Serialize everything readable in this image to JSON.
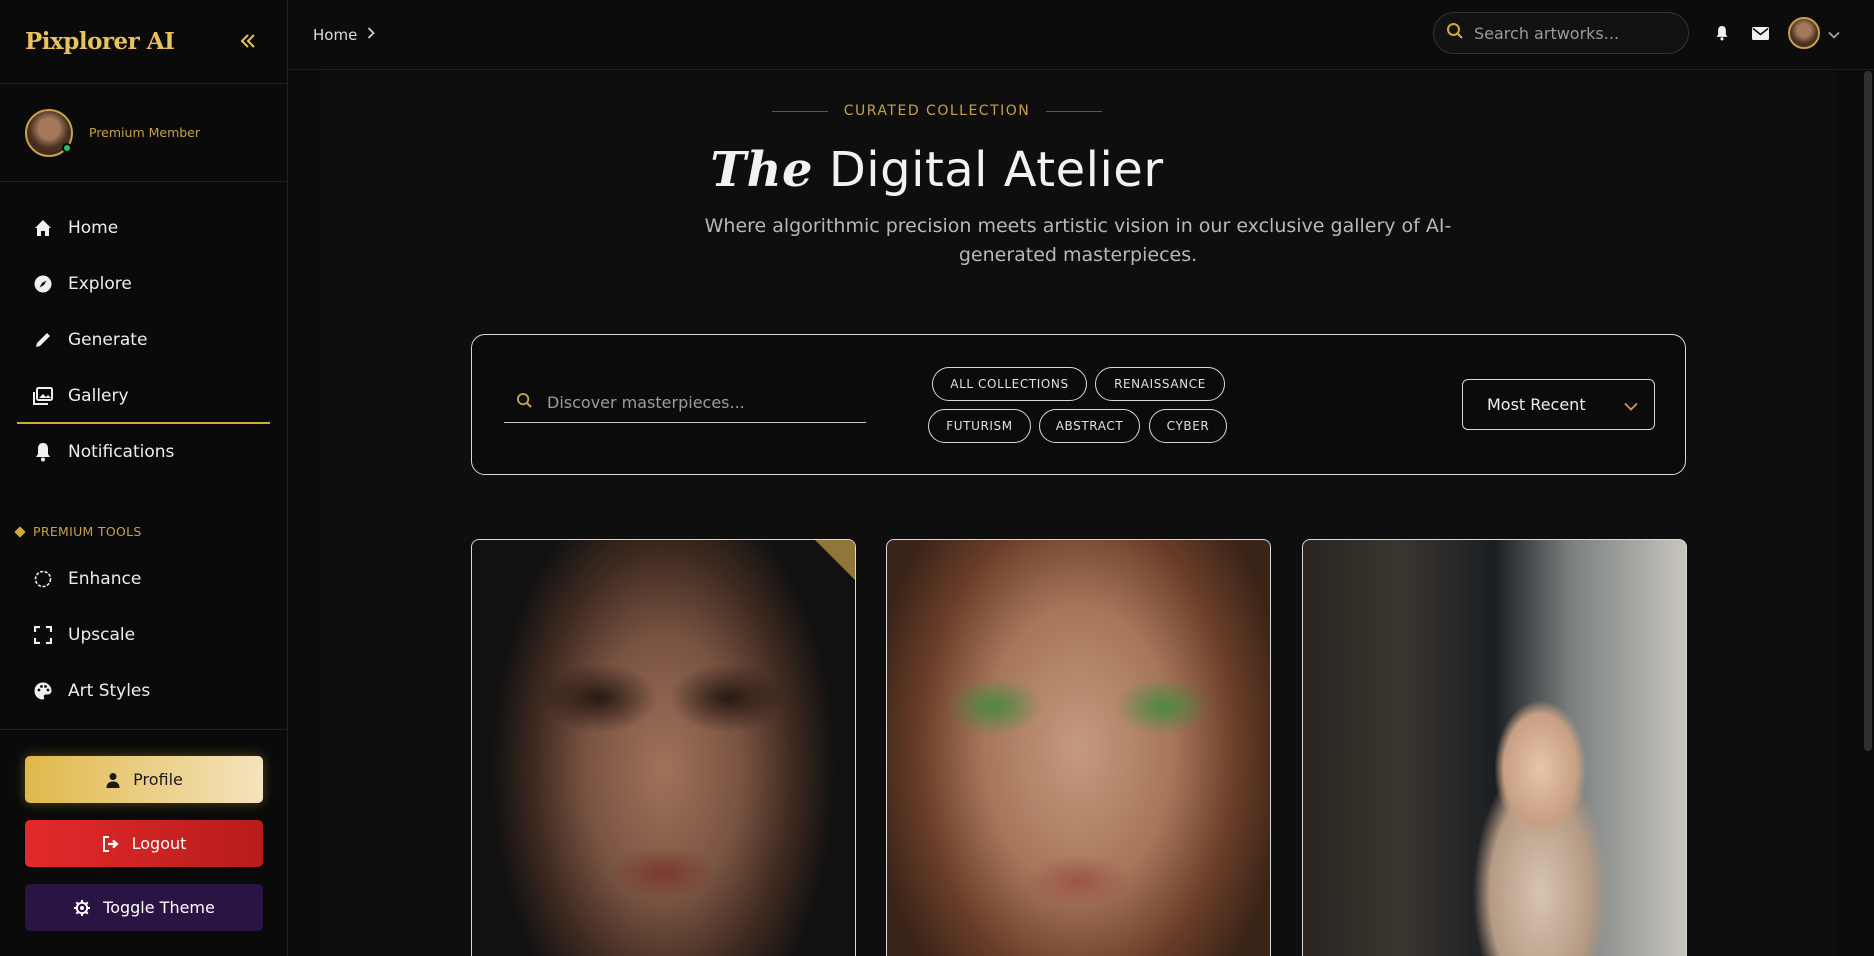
{
  "brand": {
    "name": "Pixplorer AI",
    "collapse_icon": "chevrons-left-icon"
  },
  "user": {
    "membership": "Premium Member",
    "online": true
  },
  "nav": {
    "items": [
      {
        "label": "Home",
        "icon": "home-icon",
        "active": false
      },
      {
        "label": "Explore",
        "icon": "compass-icon",
        "active": false
      },
      {
        "label": "Generate",
        "icon": "pencil-icon",
        "active": false
      },
      {
        "label": "Gallery",
        "icon": "images-icon",
        "active": true
      },
      {
        "label": "Notifications",
        "icon": "bell-icon",
        "active": false
      }
    ],
    "premium_label": "PREMIUM TOOLS",
    "premium_items": [
      {
        "label": "Enhance",
        "icon": "circle-icon"
      },
      {
        "label": "Upscale",
        "icon": "expand-icon"
      },
      {
        "label": "Art Styles",
        "icon": "palette-icon"
      }
    ]
  },
  "buttons": {
    "profile": "Profile",
    "logout": "Logout",
    "theme": "Toggle Theme"
  },
  "topbar": {
    "breadcrumb": "Home",
    "search_placeholder": "Search artworks..."
  },
  "hero": {
    "eyebrow": "CURATED COLLECTION",
    "title_em": "The",
    "title_rest": "Digital Atelier",
    "subtitle": "Where algorithmic precision meets artistic vision in our exclusive gallery of AI-generated masterpieces."
  },
  "filters": {
    "search_placeholder": "Discover masterpieces...",
    "chips": [
      "ALL COLLECTIONS",
      "RENAISSANCE",
      "FUTURISM",
      "ABSTRACT",
      "CYBER"
    ],
    "sort_selected": "Most Recent"
  },
  "colors": {
    "accent": "#d4a93c",
    "background": "#0b0b0b",
    "logout": "#e42a2a",
    "theme": "#2a1444"
  }
}
